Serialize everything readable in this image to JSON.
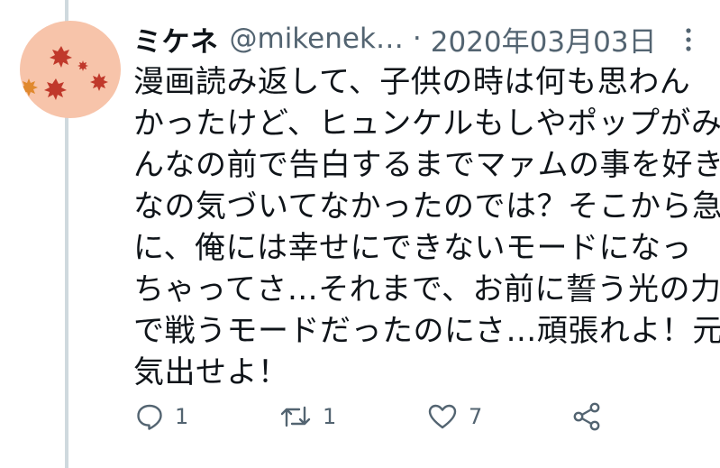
{
  "tweet": {
    "display_name": "ミケネ",
    "handle": "@mikenek…",
    "separator": "·",
    "date": "2020年03月03日",
    "text_lines": [
      "漫画読み返して、子供の時は何も思わん",
      "かったけど、ヒュンケルもしやポップがみ",
      "んなの前で告白するまでマァムの事を好き",
      "なの気づいてなかったのでは？そこから急",
      "に、俺には幸せにできないモードになっ",
      "ちゃってさ…それまで、お前に誓う光の力",
      "で戦うモードだったのにさ…頑張れよ！元",
      "気出せよ！"
    ],
    "reply_count": "1",
    "retweet_count": "1",
    "like_count": "7"
  },
  "icons": {
    "reply": "reply-icon",
    "retweet": "retweet-icon",
    "like": "heart-icon",
    "share": "share-icon",
    "more": "more-vertical-icon"
  },
  "colors": {
    "text": "#0f1419",
    "secondary": "#536471",
    "thread_line": "#cfd9de",
    "avatar_bg": "#f7c4aa",
    "leaf": "#c0392b"
  }
}
